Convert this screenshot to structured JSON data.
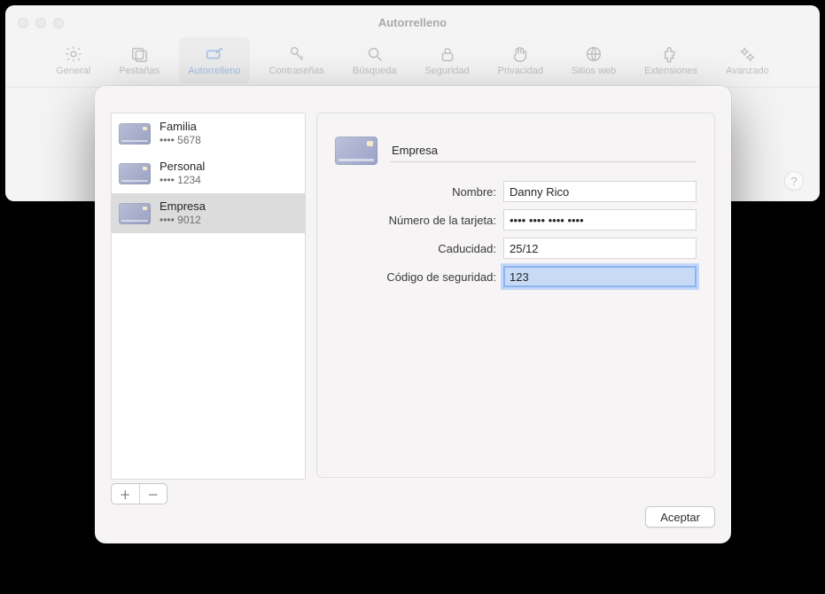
{
  "window": {
    "title": "Autorrelleno"
  },
  "toolbar": {
    "items": [
      {
        "label": "General"
      },
      {
        "label": "Pestañas"
      },
      {
        "label": "Autorrelleno"
      },
      {
        "label": "Contraseñas"
      },
      {
        "label": "Búsqueda"
      },
      {
        "label": "Seguridad"
      },
      {
        "label": "Privacidad"
      },
      {
        "label": "Sitios web"
      },
      {
        "label": "Extensiones"
      },
      {
        "label": "Avanzado"
      }
    ]
  },
  "help_glyph": "?",
  "sidebar": {
    "items": [
      {
        "name": "Familia",
        "last4": "•••• 5678"
      },
      {
        "name": "Personal",
        "last4": "•••• 1234"
      },
      {
        "name": "Empresa",
        "last4": "•••• 9012"
      }
    ]
  },
  "add_glyph": "＋",
  "remove_glyph": "－",
  "detail": {
    "description": "Empresa",
    "labels": {
      "name": "Nombre:",
      "number": "Número de la tarjeta:",
      "expiry": "Caducidad:",
      "csc": "Código de seguridad:"
    },
    "values": {
      "name": "Danny Rico",
      "number": "•••• •••• •••• ••••",
      "expiry": "25/12",
      "csc": "123"
    }
  },
  "accept_label": "Aceptar"
}
